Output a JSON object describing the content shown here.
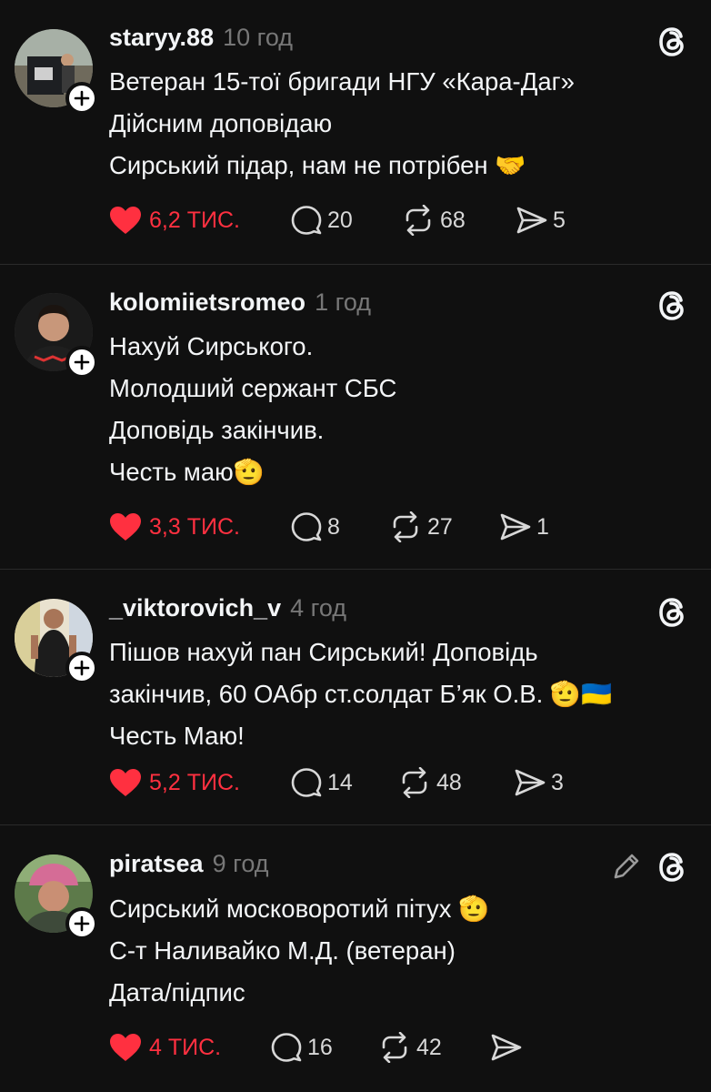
{
  "posts": [
    {
      "username": "staryy.88",
      "time": "10 год",
      "lines": [
        "Ветеран 15-тої бригади НГУ «Кара-Даг»",
        "Дійсним доповідаю",
        "Сирський підар, нам не потрібен 🤝"
      ],
      "likes": "6,2 ТИС.",
      "replies": "20",
      "reposts": "68",
      "shares": "5",
      "edited": false
    },
    {
      "username": "kolomiietsromeo",
      "time": "1 год",
      "lines": [
        "Нахуй Сирського.",
        "Молодший сержант СБС",
        "Доповідь закінчив.",
        "Честь маю🫡"
      ],
      "likes": "3,3 ТИС.",
      "replies": "8",
      "reposts": "27",
      "shares": "1",
      "edited": false
    },
    {
      "username": "_viktorovich_v",
      "time": "4 год",
      "lines": [
        "Пішов нахуй пан Сирський! Доповідь",
        "закінчив, 60  ОАбр ст.солдат Б’як О.В. 🫡🇺🇦",
        "Честь Маю!"
      ],
      "likes": "5,2 ТИС.",
      "replies": "14",
      "reposts": "48",
      "shares": "3",
      "edited": false
    },
    {
      "username": "piratsea",
      "time": "9 год",
      "lines": [
        "Сирський московоротий пітух 🫡",
        "С-т Наливайко М.Д. (ветеран)",
        "Дата/підпис"
      ],
      "likes": "4 ТИС.",
      "replies": "16",
      "reposts": "42",
      "shares": "",
      "edited": true
    }
  ],
  "icons": {
    "like": "heart-icon",
    "reply": "comment-icon",
    "repost": "repost-icon",
    "share": "send-icon",
    "brand": "threads-icon",
    "edit": "pencil-icon",
    "follow": "plus-icon"
  },
  "colors": {
    "background": "#101010",
    "like": "#ff3040",
    "text": "#f3f5f7",
    "muted": "#777777",
    "divider": "#2a2a2a"
  }
}
